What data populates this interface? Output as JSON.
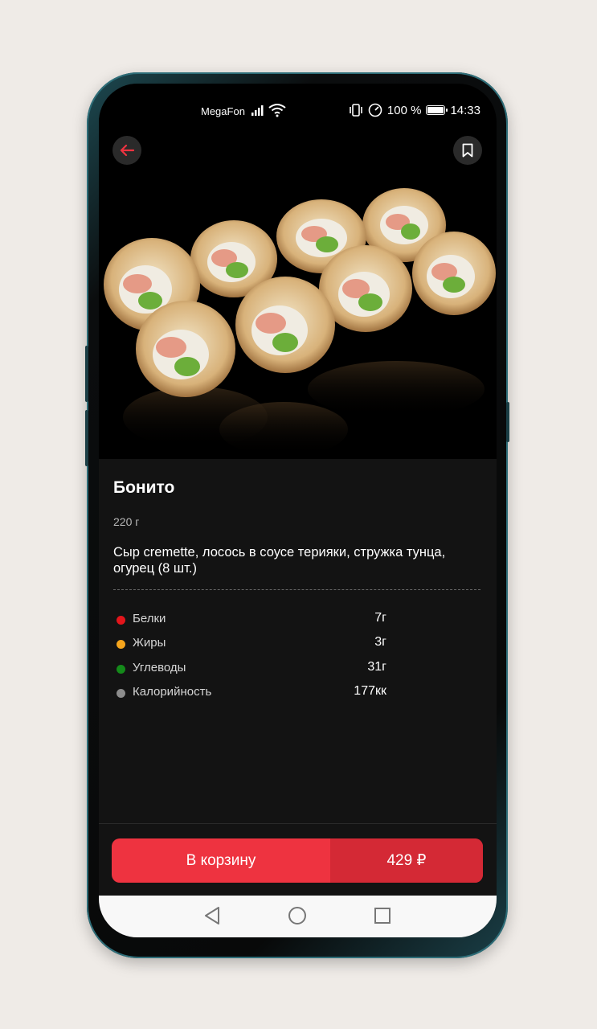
{
  "status_bar": {
    "carrier": "MegaFon",
    "battery": "100 %",
    "time": "14:33"
  },
  "product": {
    "title": "Бонито",
    "weight": "220 г",
    "description": "Сыр cremette, лосось в соусе терияки, стружка тунца, огурец (8 шт.)",
    "nutrition": [
      {
        "label": "Белки",
        "value": "7г",
        "color": "#e3151b"
      },
      {
        "label": "Жиры",
        "value": "3г",
        "color": "#f5a51c"
      },
      {
        "label": "Углеводы",
        "value": "31г",
        "color": "#148a1a"
      },
      {
        "label": "Калорийность",
        "value": "177кк",
        "color": "#8c8c8c"
      }
    ]
  },
  "cart": {
    "label": "В корзину",
    "price": "429 ₽"
  },
  "icons": {
    "back": "arrow-left-icon",
    "favorite": "bookmark-icon",
    "nav_back": "triangle-back-icon",
    "nav_home": "circle-home-icon",
    "nav_recents": "square-recents-icon"
  },
  "colors": {
    "accent": "#ee3340",
    "accent_dark": "#d42935",
    "background": "#131313"
  }
}
